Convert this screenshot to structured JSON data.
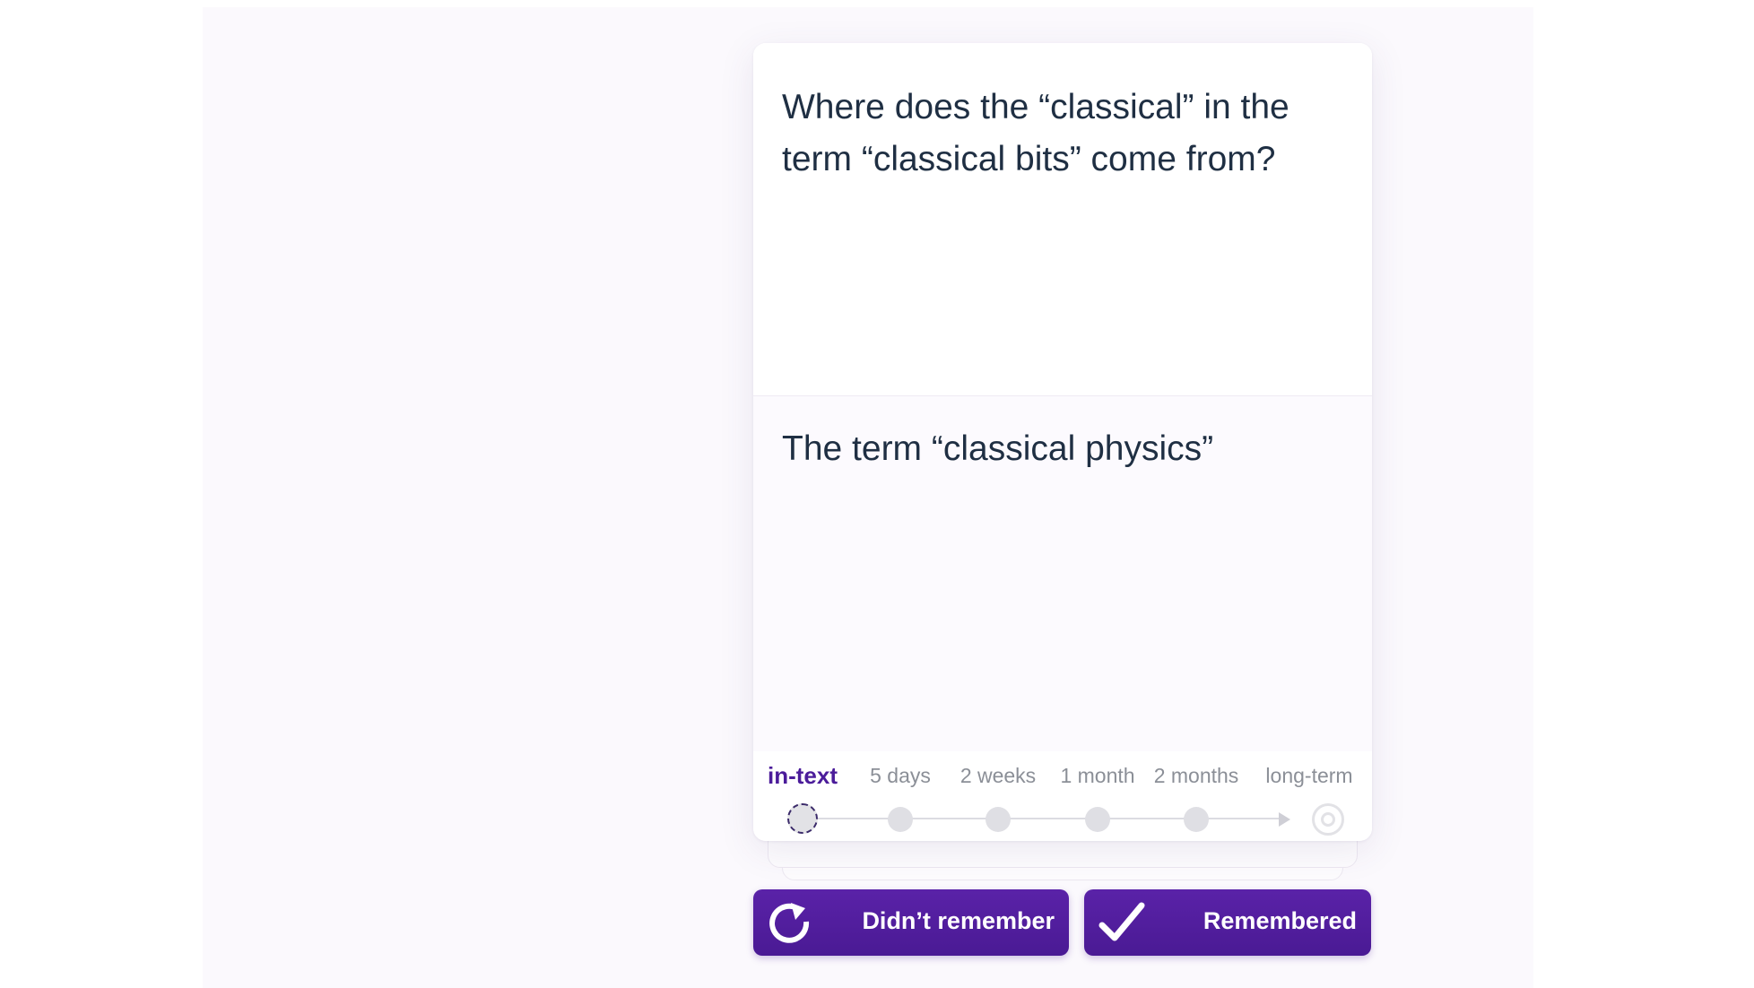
{
  "card": {
    "question": "Where does the “classical” in the term “classical bits” come from?",
    "answer": "The term “classical physics”"
  },
  "schedule": {
    "stages": [
      {
        "label": "in-text",
        "state": "current"
      },
      {
        "label": "5 days",
        "state": "upcoming"
      },
      {
        "label": "2 weeks",
        "state": "upcoming"
      },
      {
        "label": "1 month",
        "state": "upcoming"
      },
      {
        "label": "2 months",
        "state": "upcoming"
      },
      {
        "label": "long-term",
        "state": "goal"
      }
    ]
  },
  "actions": {
    "forgot_label": "Didn’t remember",
    "forgot_icon": "retry-icon",
    "remembered_label": "Remembered",
    "remembered_icon": "checkmark-icon"
  },
  "colors": {
    "accent": "#4b1c9a",
    "text": "#1f2f43",
    "muted": "#8b8f97"
  }
}
